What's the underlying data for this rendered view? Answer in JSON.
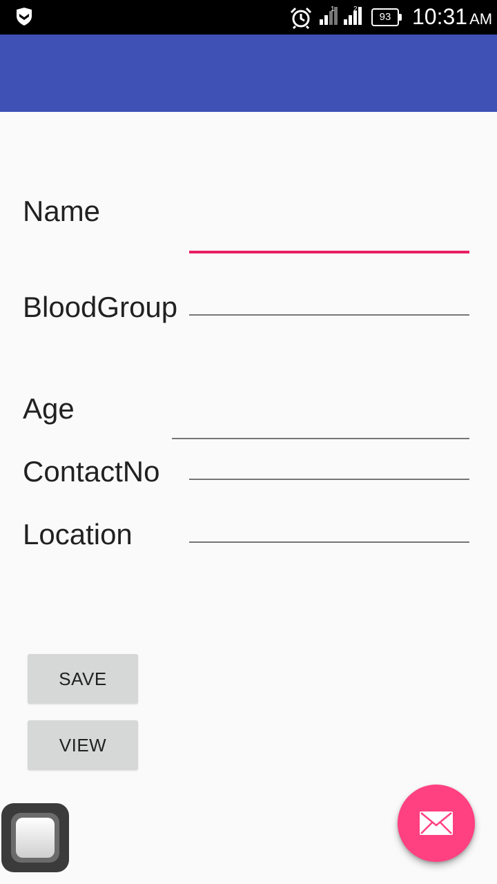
{
  "status_bar": {
    "battery_level": "93",
    "time": "10:31",
    "ampm": "AM",
    "icons": [
      "shield-icon",
      "alarm-clock-icon",
      "signal-sim1-icon",
      "signal-sim2-icon",
      "battery-icon"
    ]
  },
  "form": {
    "name_label": "Name",
    "bloodgroup_label": "BloodGroup",
    "age_label": "Age",
    "contactno_label": "ContactNo",
    "location_label": "Location",
    "name_value": "",
    "bloodgroup_value": "",
    "age_value": "",
    "contactno_value": "",
    "location_value": ""
  },
  "buttons": {
    "save_label": "SAVE",
    "view_label": "VIEW"
  },
  "fab": {
    "icon": "email-icon",
    "color": "#ff4081"
  },
  "colors": {
    "app_bar": "#3f51b5",
    "focused_underline": "#e91e63",
    "background": "#fafafa"
  }
}
